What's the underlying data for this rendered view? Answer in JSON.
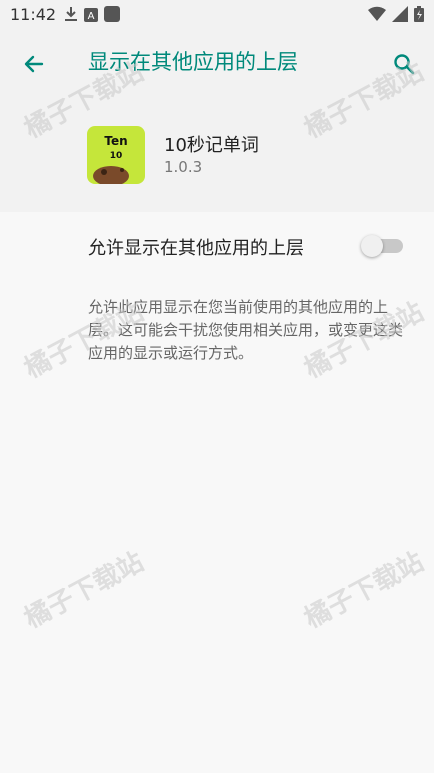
{
  "status_bar": {
    "time": "11:42",
    "icons_left": [
      "download-icon",
      "a-badge-icon",
      "square-icon"
    ],
    "icons_right": [
      "wifi-icon",
      "signal-icon",
      "battery-icon"
    ]
  },
  "app_bar": {
    "title": "显示在其他应用的上层",
    "accent_color": "#00897b"
  },
  "app": {
    "name": "10秒记单词",
    "version": "1.0.3",
    "icon_text_top": "Ten",
    "icon_text_mid": "10"
  },
  "setting": {
    "label": "允许显示在其他应用的上层",
    "enabled": false
  },
  "description": "允许此应用显示在您当前使用的其他应用的上层。这可能会干扰您使用相关应用，或变更这类应用的显示或运行方式。",
  "watermark": "橘子下载站"
}
